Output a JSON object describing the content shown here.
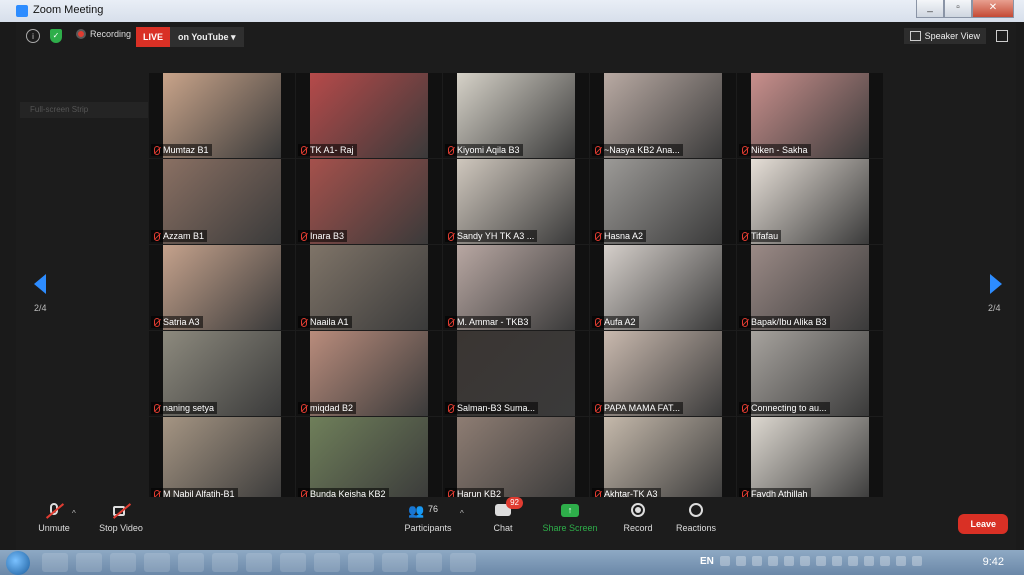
{
  "window": {
    "title": "Zoom Meeting",
    "btn_min": "_",
    "btn_max": "▫",
    "btn_close": "✕"
  },
  "topbar": {
    "info_icon": "i",
    "shield_icon": "✓",
    "recording_label": "Recording",
    "live_label": "LIVE",
    "stream_label": "on YouTube",
    "stream_caret": "▾",
    "speaker_view_label": "Speaker View"
  },
  "sidebar_hint": "Full-screen Strip",
  "pagination": {
    "left": "2/4",
    "right": "2/4"
  },
  "tiles": [
    {
      "name": "Mumtaz B1",
      "bg": "#c9a48a"
    },
    {
      "name": "TK A1- Raj",
      "bg": "#b64a4a"
    },
    {
      "name": "Kiyomi Aqila B3",
      "bg": "#d6d2c8"
    },
    {
      "name": "~Nasya KB2 Ana...",
      "bg": "#b9aaa3"
    },
    {
      "name": "Niken - Sakha",
      "bg": "#c98f8c"
    },
    {
      "name": "Azzam B1",
      "bg": "#8a7063"
    },
    {
      "name": "Inara B3",
      "bg": "#a5514c"
    },
    {
      "name": "Sandy YH TK A3 ...",
      "bg": "#cfc7bd"
    },
    {
      "name": "Hasna A2",
      "bg": "#9c9a97"
    },
    {
      "name": "Tifafau",
      "bg": "#e6dfd7"
    },
    {
      "name": "Satria A3",
      "bg": "#c5a28c"
    },
    {
      "name": "Naaila A1",
      "bg": "#7f7468"
    },
    {
      "name": "M. Ammar - TKB3",
      "bg": "#b8a7a2"
    },
    {
      "name": "Aufa A2",
      "bg": "#d5cfca"
    },
    {
      "name": "Bapak/Ibu Alika B3",
      "bg": "#9b8a86"
    },
    {
      "name": "naning setya",
      "bg": "#8d8a7e"
    },
    {
      "name": "miqdad B2",
      "bg": "#b98c7c"
    },
    {
      "name": "Salman-B3 Suma...",
      "bg": "#3a3532"
    },
    {
      "name": "PAPA MAMA FAT...",
      "bg": "#c9b9ae"
    },
    {
      "name": "Connecting to au...",
      "bg": "#a7a39e"
    },
    {
      "name": "M Nabil Alfatih-B1",
      "bg": "#a59583"
    },
    {
      "name": "Bunda Keisha KB2",
      "bg": "#6f7f5a"
    },
    {
      "name": "Harun KB2",
      "bg": "#8e7d73"
    },
    {
      "name": "Akhtar-TK A3",
      "bg": "#c5b9ab"
    },
    {
      "name": "Faydh Athillah",
      "bg": "#ddd8d0"
    }
  ],
  "toolbar": {
    "unmute_label": "Unmute",
    "stop_video_label": "Stop Video",
    "participants_label": "Participants",
    "participants_count": "76",
    "chat_label": "Chat",
    "chat_badge": "92",
    "share_screen_label": "Share Screen",
    "record_label": "Record",
    "reactions_label": "Reactions",
    "leave_label": "Leave",
    "caret": "^"
  },
  "taskbar": {
    "lang": "EN",
    "time": "9:42"
  },
  "colors": {
    "accent": "#2d8cff",
    "live": "#d93025",
    "share": "#2eae4a",
    "leave": "#d93025"
  }
}
